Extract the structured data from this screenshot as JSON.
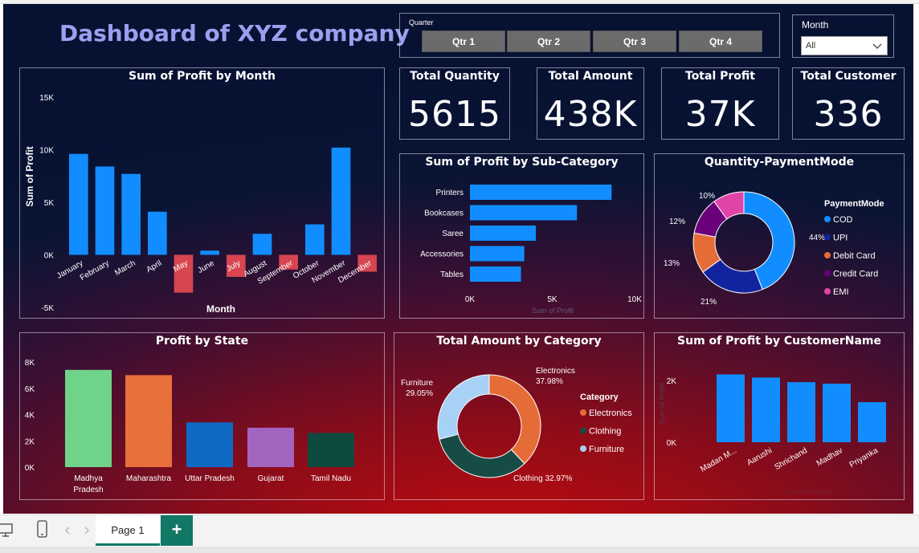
{
  "dashboard": {
    "title": "Dashboard of XYZ company"
  },
  "quarter_slicer": {
    "label": "Quarter",
    "buttons": [
      "Qtr 1",
      "Qtr 2",
      "Qtr 3",
      "Qtr 4"
    ]
  },
  "month_slicer": {
    "label": "Month",
    "value": "All"
  },
  "cards": [
    {
      "title": "Total Quantity",
      "value": "5615"
    },
    {
      "title": "Total Amount",
      "value": "438K"
    },
    {
      "title": "Total Profit",
      "value": "37K"
    },
    {
      "title": "Total Customer",
      "value": "336"
    }
  ],
  "chart_data": [
    {
      "id": "profit_by_month",
      "type": "bar",
      "title": "Sum of Profit by Month",
      "xlabel": "Month",
      "ylabel": "Sum of Profit",
      "ylim": [
        -5000,
        15000
      ],
      "yticks": [
        15000,
        10000,
        5000,
        0,
        -5000
      ],
      "yticklabels": [
        "15K",
        "10K",
        "5K",
        "0K",
        "-5K"
      ],
      "categories": [
        "January",
        "February",
        "March",
        "April",
        "May",
        "June",
        "July",
        "August",
        "September",
        "October",
        "November",
        "December"
      ],
      "values": [
        9600,
        8400,
        7700,
        4100,
        -3600,
        400,
        -2100,
        2000,
        -1400,
        2900,
        10200,
        -1600
      ],
      "colors": {
        "positive": "#118dff",
        "negative": "#d64550"
      }
    },
    {
      "id": "profit_by_subcategory",
      "type": "bar",
      "orientation": "horizontal",
      "title": "Sum of Profit by Sub-Category",
      "xlabel": "Sum of Profit",
      "xlim": [
        0,
        10000
      ],
      "xticks": [
        0,
        5000,
        10000
      ],
      "xticklabels": [
        "0K",
        "5K",
        "10K"
      ],
      "categories": [
        "Printers",
        "Bookcases",
        "Saree",
        "Accessories",
        "Tables"
      ],
      "values": [
        8600,
        6500,
        4000,
        3300,
        3100
      ],
      "color": "#118dff"
    },
    {
      "id": "quantity_paymentmode",
      "type": "pie",
      "donut": true,
      "title": "Quantity-PaymentMode",
      "legend_title": "PaymentMode",
      "legend_position": "right",
      "labels": [
        "COD",
        "UPI",
        "Debit Card",
        "Credit Card",
        "EMI"
      ],
      "values": [
        44,
        21,
        13,
        12,
        10
      ],
      "data_labels": [
        "44%",
        "21%",
        "13%",
        "12%",
        "10%"
      ],
      "colors": [
        "#118dff",
        "#12239e",
        "#e66c37",
        "#6b007b",
        "#e044a7"
      ]
    },
    {
      "id": "profit_by_state",
      "type": "bar",
      "title": "Profit by State",
      "ylim": [
        0,
        8000
      ],
      "yticks": [
        8000,
        6000,
        4000,
        2000,
        0
      ],
      "yticklabels": [
        "8K",
        "6K",
        "4K",
        "2K",
        "0K"
      ],
      "categories": [
        "Madhya Pradesh",
        "Maharashtra",
        "Uttar Pradesh",
        "Gujarat",
        "Tamil Nadu"
      ],
      "values": [
        7400,
        7000,
        3400,
        3000,
        2600
      ],
      "colors": [
        "#6fd38a",
        "#e8703a",
        "#0f6ac4",
        "#a364bf",
        "#0f4a40"
      ]
    },
    {
      "id": "amount_by_category",
      "type": "pie",
      "donut": true,
      "title": "Total Amount by Category",
      "legend_title": "Category",
      "legend_position": "right",
      "labels": [
        "Electronics",
        "Clothing",
        "Furniture"
      ],
      "values": [
        37.98,
        32.97,
        29.05
      ],
      "data_labels": [
        "Electronics\n37.98%",
        "Clothing 32.97%",
        "Furniture\n29.05%"
      ],
      "colors": [
        "#e66c37",
        "#174b46",
        "#a7d1f5"
      ]
    },
    {
      "id": "profit_by_customer",
      "type": "bar",
      "title": "Sum of Profit by CustomerName",
      "xlabel": "CustomerName",
      "ylabel": "Sum of Profit",
      "ylim": [
        0,
        2500
      ],
      "yticks": [
        2000,
        0
      ],
      "yticklabels": [
        "2K",
        "0K"
      ],
      "categories": [
        "Madan M...",
        "Aarushi",
        "Shrichand",
        "Madhav",
        "Priyanka"
      ],
      "values": [
        2200,
        2100,
        1950,
        1900,
        1300
      ],
      "color": "#118dff"
    }
  ],
  "tabs": {
    "page": "Page 1",
    "add": "+"
  }
}
